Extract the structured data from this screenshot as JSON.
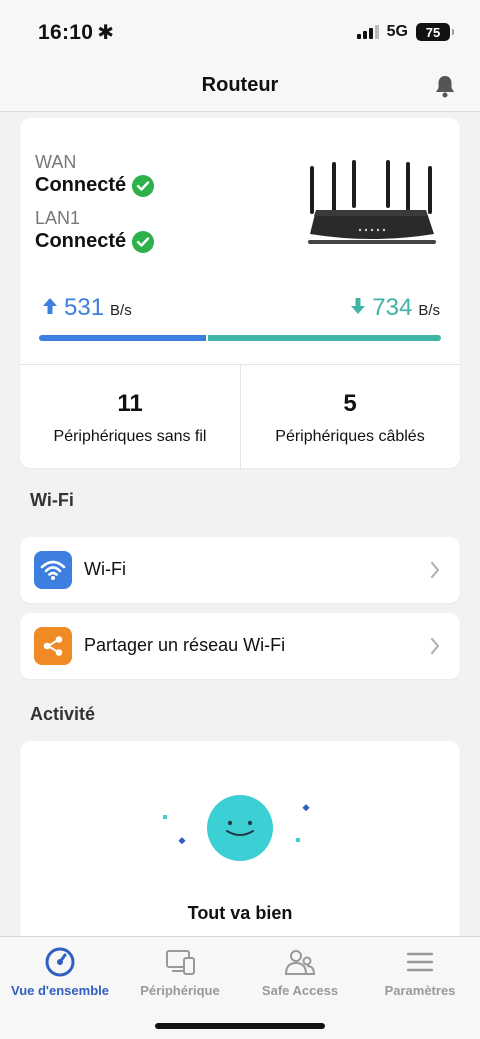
{
  "status_bar": {
    "time": "16:10",
    "time_icon": "✱",
    "network": "5G",
    "battery": "75"
  },
  "header": {
    "title": "Routeur"
  },
  "connection": {
    "wan_label": "WAN",
    "wan_status": "Connecté",
    "lan_label": "LAN1",
    "lan_status": "Connecté"
  },
  "speed": {
    "upload_value": "531",
    "upload_unit": "B/s",
    "download_value": "734",
    "download_unit": "B/s",
    "upload_color": "#3d7fe0",
    "download_color": "#3fb3a4"
  },
  "devices": {
    "wireless_count": "11",
    "wireless_label": "Périphériques sans fil",
    "wired_count": "5",
    "wired_label": "Périphériques câblés"
  },
  "wifi_section": {
    "title": "Wi-Fi",
    "items": [
      {
        "label": "Wi-Fi",
        "icon": "wifi-icon",
        "color": "#3d7fe0"
      },
      {
        "label": "Partager un réseau Wi-Fi",
        "icon": "share-icon",
        "color": "#f08a24"
      }
    ]
  },
  "activity": {
    "title": "Activité",
    "status": "Tout va bien",
    "face_color": "#3ccfd3"
  },
  "tabs": [
    {
      "label": "Vue d'ensemble",
      "icon": "dashboard-icon",
      "active": true
    },
    {
      "label": "Périphérique",
      "icon": "devices-icon",
      "active": false
    },
    {
      "label": "Safe Access",
      "icon": "users-icon",
      "active": false
    },
    {
      "label": "Paramètres",
      "icon": "menu-icon",
      "active": false
    }
  ]
}
